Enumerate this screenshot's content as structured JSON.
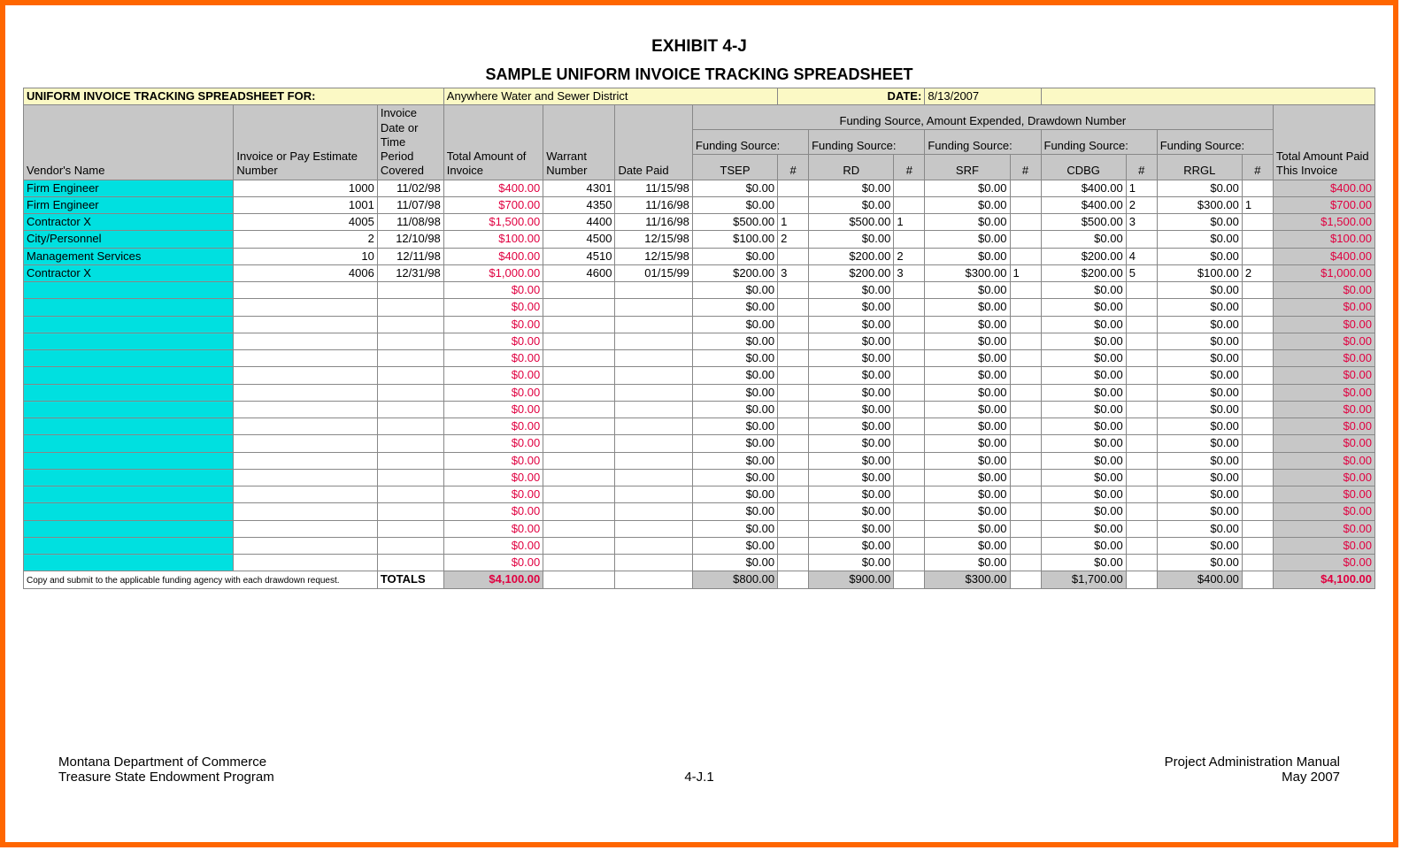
{
  "exhibit_label": "EXHIBIT 4-J",
  "title": "SAMPLE UNIFORM INVOICE TRACKING SPREADSHEET",
  "banner_prefix": "UNIFORM INVOICE TRACKING SPREADSHEET FOR:",
  "banner_entity": "Anywhere Water and Sewer District",
  "banner_date_label": "DATE:",
  "banner_date": "8/13/2007",
  "hdr": {
    "vendor": "Vendor's Name",
    "invoice": "Invoice or Pay Estimate Number",
    "invdate": "Invoice Date or Time Period Covered",
    "totalinv": "Total Amount of Invoice",
    "warrant": "Warrant Number",
    "datepaid": "Date Paid",
    "funding_title": "Funding Source, Amount Expended, Drawdown Number",
    "totalpaid": "Total Amount Paid This Invoice",
    "src_label": "Funding Source:",
    "num_hash": "#",
    "sources": [
      "TSEP",
      "RD",
      "SRF",
      "CDBG",
      "RRGL"
    ]
  },
  "rows": [
    {
      "vendor": "Firm Engineer",
      "inv": "1000",
      "idate": "11/02/98",
      "tot": "$400.00",
      "war": "4301",
      "dpaid": "11/15/98",
      "s": [
        [
          "$0.00",
          ""
        ],
        [
          "$0.00",
          ""
        ],
        [
          "$0.00",
          ""
        ],
        [
          "$400.00",
          "1"
        ],
        [
          "$0.00",
          ""
        ]
      ],
      "tpaid": "$400.00"
    },
    {
      "vendor": "Firm Engineer",
      "inv": "1001",
      "idate": "11/07/98",
      "tot": "$700.00",
      "war": "4350",
      "dpaid": "11/16/98",
      "s": [
        [
          "$0.00",
          ""
        ],
        [
          "$0.00",
          ""
        ],
        [
          "$0.00",
          ""
        ],
        [
          "$400.00",
          "2"
        ],
        [
          "$300.00",
          "1"
        ]
      ],
      "tpaid": "$700.00"
    },
    {
      "vendor": "Contractor X",
      "inv": "4005",
      "idate": "11/08/98",
      "tot": "$1,500.00",
      "war": "4400",
      "dpaid": "11/16/98",
      "s": [
        [
          "$500.00",
          "1"
        ],
        [
          "$500.00",
          "1"
        ],
        [
          "$0.00",
          ""
        ],
        [
          "$500.00",
          "3"
        ],
        [
          "$0.00",
          ""
        ]
      ],
      "tpaid": "$1,500.00"
    },
    {
      "vendor": "City/Personnel",
      "inv": "2",
      "idate": "12/10/98",
      "tot": "$100.00",
      "war": "4500",
      "dpaid": "12/15/98",
      "s": [
        [
          "$100.00",
          "2"
        ],
        [
          "$0.00",
          ""
        ],
        [
          "$0.00",
          ""
        ],
        [
          "$0.00",
          ""
        ],
        [
          "$0.00",
          ""
        ]
      ],
      "tpaid": "$100.00"
    },
    {
      "vendor": "Management Services",
      "inv": "10",
      "idate": "12/11/98",
      "tot": "$400.00",
      "war": "4510",
      "dpaid": "12/15/98",
      "s": [
        [
          "$0.00",
          ""
        ],
        [
          "$200.00",
          "2"
        ],
        [
          "$0.00",
          ""
        ],
        [
          "$200.00",
          "4"
        ],
        [
          "$0.00",
          ""
        ]
      ],
      "tpaid": "$400.00"
    },
    {
      "vendor": "Contractor X",
      "inv": "4006",
      "idate": "12/31/98",
      "tot": "$1,000.00",
      "war": "4600",
      "dpaid": "01/15/99",
      "s": [
        [
          "$200.00",
          "3"
        ],
        [
          "$200.00",
          "3"
        ],
        [
          "$300.00",
          "1"
        ],
        [
          "$200.00",
          "5"
        ],
        [
          "$100.00",
          "2"
        ]
      ],
      "tpaid": "$1,000.00"
    }
  ],
  "empty_rows": 17,
  "empty": {
    "tot": "$0.00",
    "s": "$0.00",
    "tpaid": "$0.00"
  },
  "totals": {
    "note": "Copy and submit to the applicable funding agency with each drawdown request.",
    "label": "TOTALS",
    "tot": "$4,100.00",
    "s": [
      "$800.00",
      "$900.00",
      "$300.00",
      "$1,700.00",
      "$400.00"
    ],
    "tpaid": "$4,100.00"
  },
  "footer": {
    "l1": "Montana Department of Commerce",
    "l2": "Treasure State Endowment Program",
    "c": "4-J.1",
    "r1": "Project Administration Manual",
    "r2": "May 2007"
  }
}
